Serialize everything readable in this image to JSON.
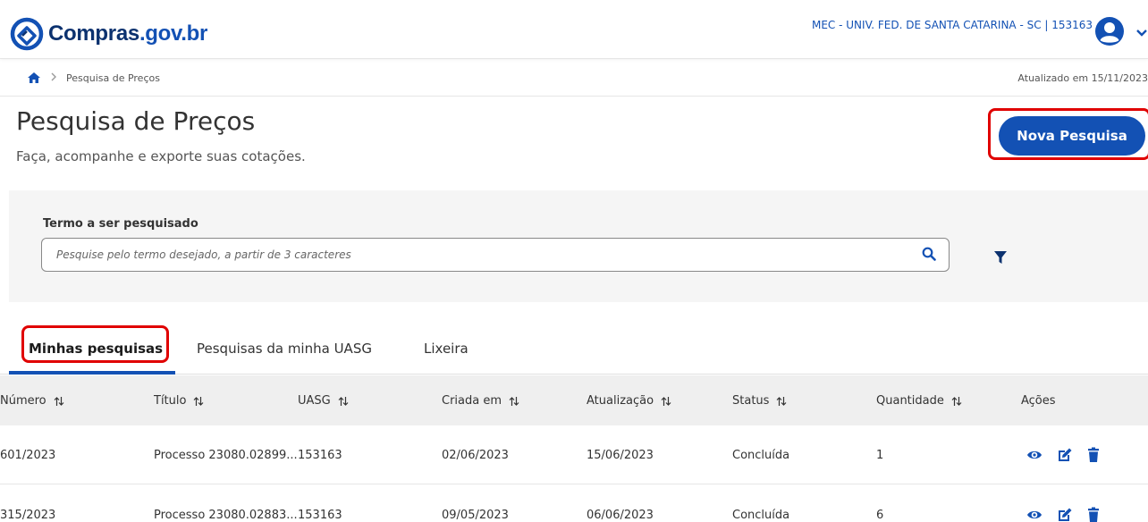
{
  "header": {
    "logo_main": "Compras",
    "logo_suffix": ".gov.br",
    "org_label": "MEC - UNIV. FED. DE SANTA CATARINA - SC | 153163",
    "icons": {
      "logo": "compras-logo-icon",
      "avatar": "user-avatar-icon",
      "caret": "chevron-down-icon"
    }
  },
  "breadcrumb": {
    "current": "Pesquisa de Preços",
    "updated": "Atualizado em 15/11/2023"
  },
  "page": {
    "title": "Pesquisa de Preços",
    "subtitle": "Faça, acompanhe e exporte suas cotações.",
    "new_button": "Nova Pesquisa"
  },
  "search": {
    "label": "Termo a ser pesquisado",
    "value": "",
    "placeholder": "Pesquise pelo termo desejado, a partir de 3 caracteres"
  },
  "tabs": [
    {
      "label": "Minhas pesquisas",
      "active": true
    },
    {
      "label": "Pesquisas da minha UASG",
      "active": false
    },
    {
      "label": "Lixeira",
      "active": false
    }
  ],
  "table": {
    "columns": [
      "Número",
      "Título",
      "UASG",
      "Criada em",
      "Atualização",
      "Status",
      "Quantidade",
      "Ações"
    ],
    "rows": [
      {
        "numero": "601/2023",
        "titulo": "Processo 23080.02899...",
        "uasg": "153163",
        "criada": "02/06/2023",
        "atualizacao": "15/06/2023",
        "status": "Concluída",
        "quantidade": "1"
      },
      {
        "numero": "315/2023",
        "titulo": "Processo 23080.02883...",
        "uasg": "153163",
        "criada": "09/05/2023",
        "atualizacao": "06/06/2023",
        "status": "Concluída",
        "quantidade": "6"
      }
    ]
  },
  "colors": {
    "primary": "#1351b4",
    "brand_dark": "#0c326f",
    "highlight": "#e00000"
  }
}
